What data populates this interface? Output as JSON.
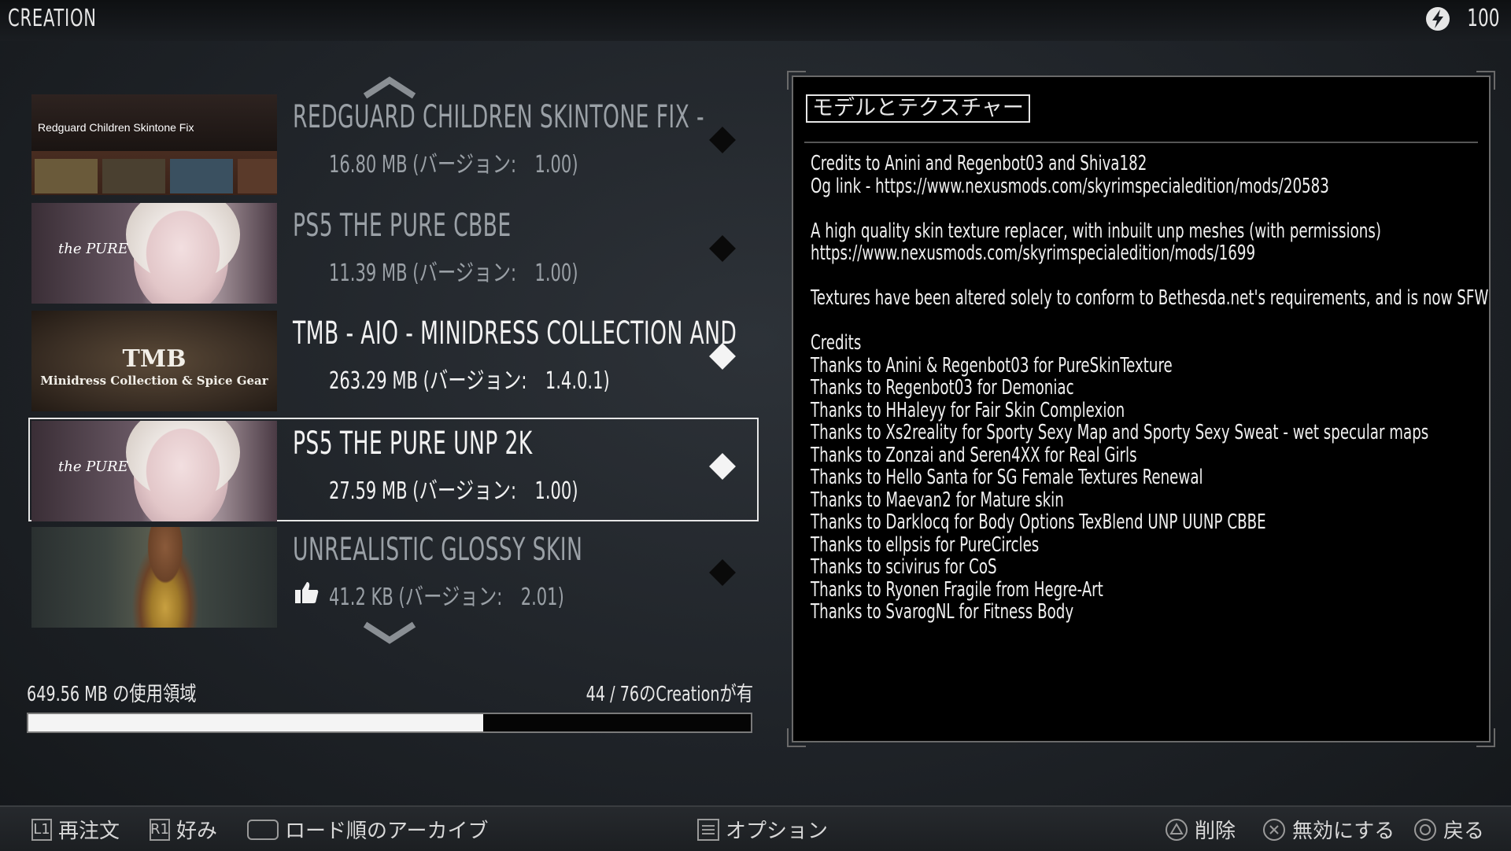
{
  "app": {
    "title": "CREATION",
    "credits": "100"
  },
  "list": {
    "items": [
      {
        "title": "REDGUARD CHILDREN SKINTONE FIX -",
        "meta": "16.80 MB (バージョン:　1.00)",
        "thumb_text": "Redguard Children Skintone Fix",
        "enabled": false,
        "selected": false,
        "liked": false
      },
      {
        "title": "PS5 THE PURE CBBE",
        "meta": "11.39 MB (バージョン:　1.00)",
        "thumb_text": "the PURE",
        "enabled": false,
        "selected": false,
        "liked": false
      },
      {
        "title": "TMB - AIO - MINIDRESS COLLECTION AND",
        "meta": "263.29 MB (バージョン:　1.4.0.1)",
        "thumb_text": "TMB",
        "thumb_sub": "Minidress Collection & Spice Gear",
        "enabled": true,
        "selected": false,
        "liked": false
      },
      {
        "title": "PS5 THE PURE UNP 2K",
        "meta": "27.59 MB (バージョン:　1.00)",
        "thumb_text": "the PURE",
        "enabled": true,
        "selected": true,
        "liked": false
      },
      {
        "title": "UNREALISTIC GLOSSY SKIN",
        "meta": "41.2 KB (バージョン:　2.01)",
        "enabled": false,
        "selected": false,
        "liked": true
      }
    ]
  },
  "storage": {
    "used_label": "649.56 MB の使用領域",
    "count_label": "44 / 76のCreationが有",
    "fill_fraction": 0.63
  },
  "detail": {
    "category": "モデルとテクスチャー",
    "lines": [
      "Credits to Anini and Regenbot03 and Shiva182",
      "Og link - https://www.nexusmods.com/skyrimspecialedition/mods/20583",
      "",
      "A high quality skin texture replacer, with inbuilt unp meshes (with permissions)",
      "https://www.nexusmods.com/skyrimspecialedition/mods/1699",
      "",
      "Textures have been altered solely to conform to Bethesda.net's requirements, and is now SFW",
      "",
      "Credits",
      "Thanks to Anini & Regenbot03 for PureSkinTexture",
      "Thanks to Regenbot03 for Demoniac",
      "Thanks to HHaleyy for Fair Skin Complexion",
      "Thanks to Xs2reality for Sporty Sexy Map and Sporty Sexy Sweat - wet specular maps",
      "Thanks to Zonzai and Seren4XX for Real Girls",
      "Thanks to Hello Santa for SG Female Textures Renewal",
      "Thanks to Maevan2 for Mature skin",
      "Thanks to Darklocq for Body Options TexBlend UNP UUNP CBBE",
      "Thanks to ellpsis for PureCircles",
      "Thanks to scivirus for CoS",
      "Thanks to Ryonen Fragile from Hegre-Art",
      "Thanks to SvarogNL for Fitness Body"
    ]
  },
  "hints": {
    "l1_button": "L1",
    "l1_label": "再注文",
    "r1_button": "R1",
    "r1_label": "好み",
    "touchpad_label": "ロード順のアーカイブ",
    "options_label": "オプション",
    "delete_label": "削除",
    "disable_label": "無効にする",
    "back_label": "戻る"
  }
}
